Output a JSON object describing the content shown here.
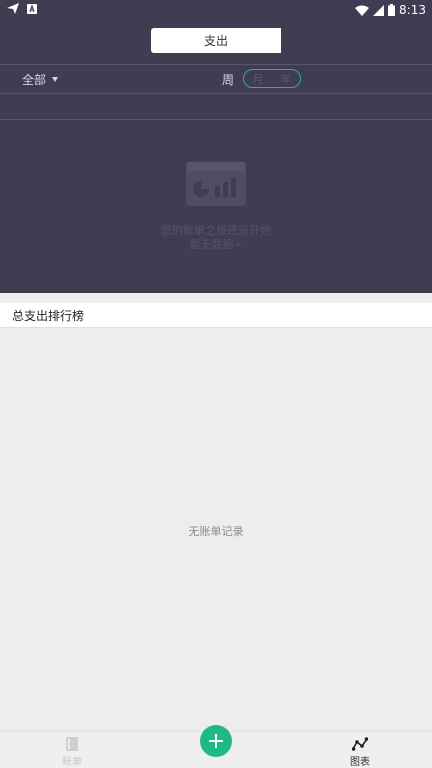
{
  "status_bar": {
    "time": "8:13",
    "left_icons": [
      "send-icon",
      "a-badge-icon"
    ],
    "right_icons": [
      "wifi-icon",
      "signal-icon",
      "battery-icon"
    ]
  },
  "header": {
    "tabs": [
      {
        "label": "支出",
        "selected": true
      }
    ],
    "filter": {
      "label": "全部"
    },
    "periods": [
      {
        "label": "周",
        "selected": false
      },
      {
        "label": "月",
        "selected": true
      },
      {
        "label": "年",
        "selected": false
      }
    ],
    "empty_state": {
      "line1": "您的账单之旅还没开始",
      "line2": "暂无数据~",
      "icon": "chart-card-icon"
    }
  },
  "ranking": {
    "title": "总支出排行榜",
    "empty_text": "无账单记录"
  },
  "bottom_nav": {
    "items": [
      {
        "label": "账单",
        "icon": "book-icon",
        "active": false
      },
      {
        "label": "图表",
        "icon": "line-chart-icon",
        "active": true
      }
    ],
    "add_button_icon": "plus-icon"
  },
  "colors": {
    "header_bg": "#403d53",
    "accent": "#1fb887",
    "page_bg": "#ededed"
  }
}
